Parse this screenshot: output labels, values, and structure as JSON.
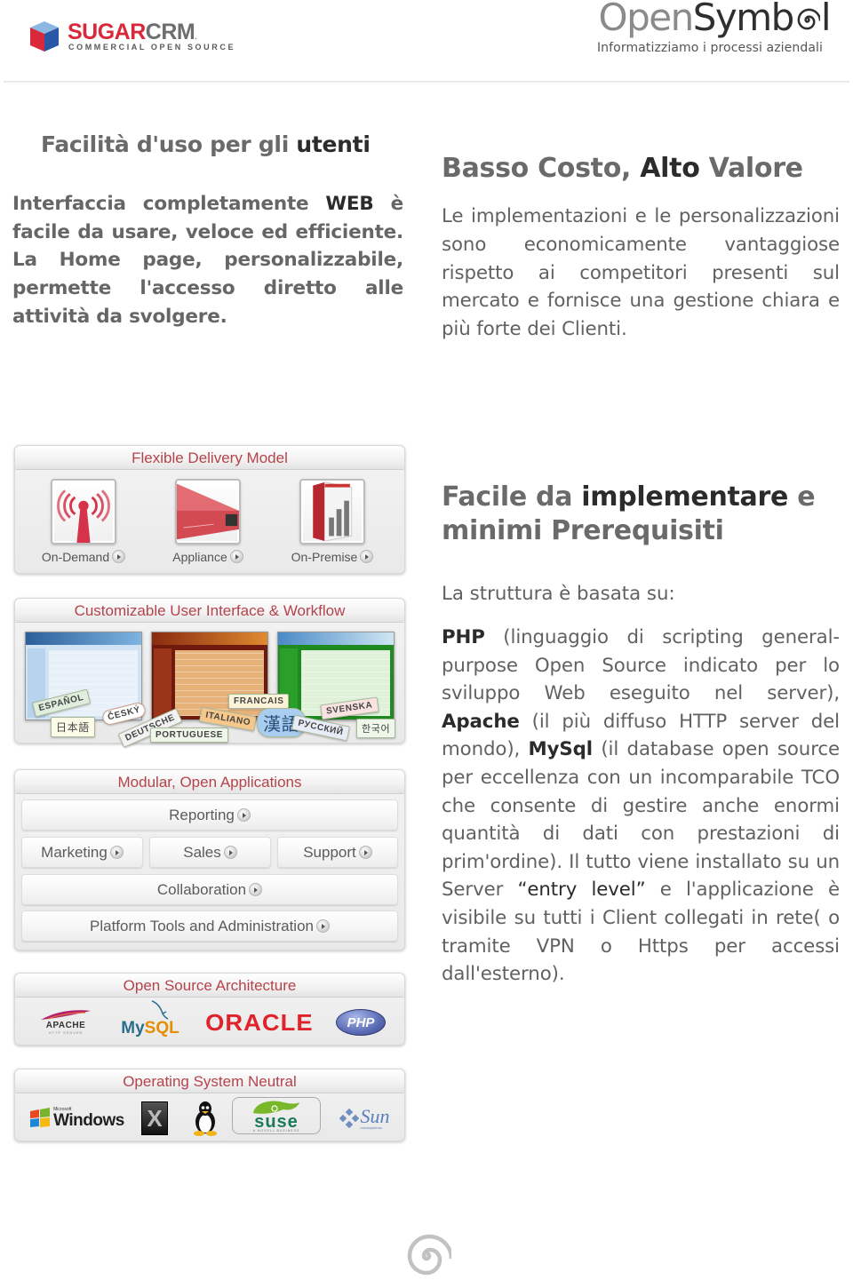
{
  "header": {
    "sugar_logo": {
      "word_red": "SUGAR",
      "word_grey": "CRM",
      "tm": ".",
      "subtitle": "COMMERCIAL OPEN SOURCE",
      "cube_colors": {
        "top": "#8db7e2",
        "left": "#d8283a",
        "right": "#2a56a6"
      }
    },
    "opensymbol_logo": {
      "word_light": "Open",
      "word_dark_a": "Symb",
      "word_dark_b": "l",
      "tagline": "Informatizziamo i processi aziendali"
    }
  },
  "section_ease": {
    "title_light": "Facilità d'uso per gli ",
    "title_dark": "utenti",
    "body_a": "Interfaccia completamente ",
    "body_bold": "WEB",
    "body_b": " è facile da usare, veloce ed efficiente. La Home page, personalizzabile, permette l'accesso diretto alle attività da svolgere."
  },
  "section_cost": {
    "title_light": "Basso Costo, ",
    "title_dark": "Alto",
    "title_light2": " Valore",
    "body": "Le implementazioni e le personalizzazioni sono economicamente vantaggiose rispetto ai competitori presenti sul mercato e fornisce una gestione chiara e più forte dei Clienti."
  },
  "section_impl": {
    "title_light": "Facile da ",
    "title_dark": "implementare",
    "title_light2": " e minimi Prerequisiti",
    "intro": "La struttura è basata su:",
    "php": "PHP",
    "php_desc": " (linguaggio di scripting general-purpose Open Source indicato per lo sviluppo Web eseguito nel server), ",
    "apache": "Apache",
    "apache_desc": " (il più diffuso HTTP server del mondo), ",
    "mysql": "MySql",
    "mysql_desc": " (il database open source per eccellenza con un incomparabile TCO che consente di gestire anche enormi quantità di dati con prestazioni di prim'ordine). Il tutto viene installato su un Server ",
    "entry": "“entry level”",
    "rest": " e l'applicazione è visibile su tutti i Client collegati in rete( o tramite VPN o Https per accessi dall'esterno)."
  },
  "panels": {
    "delivery": {
      "title": "Flexible Delivery Model",
      "items": [
        {
          "label": "On-Demand",
          "icon": "antenna-icon"
        },
        {
          "label": "Appliance",
          "icon": "server-appliance-icon"
        },
        {
          "label": "On-Premise",
          "icon": "software-box-icon"
        }
      ]
    },
    "ui": {
      "title": "Customizable User Interface & Workflow",
      "themes": [
        "blue",
        "orange",
        "green"
      ],
      "languages": [
        "ESPAÑOL",
        "日本語",
        "ČESKÝ",
        "DEUTSCHE",
        "PORTUGUESE",
        "FRANCAIS",
        "ITALIANO",
        "漢語",
        "РУССКИЙ",
        "SVENSKA",
        "한국어"
      ]
    },
    "modular": {
      "title": "Modular, Open Applications",
      "buttons": {
        "reporting": "Reporting",
        "marketing": "Marketing",
        "sales": "Sales",
        "support": "Support",
        "collaboration": "Collaboration",
        "platform": "Platform Tools and Administration"
      }
    },
    "architecture": {
      "title": "Open Source Architecture",
      "logos": {
        "apache": "APACHE",
        "apache_sub": "HTTP SERVER",
        "mysql_a": "My",
        "mysql_b": "SQL",
        "oracle": "ORACLE",
        "php": "PHP"
      }
    },
    "os": {
      "title": "Operating System Neutral",
      "logos": {
        "windows_small": "Microsoft",
        "windows": "Windows",
        "mac": "X",
        "suse": "suse",
        "suse_sub": "A NOVELL BUSINESS",
        "sun": "Sun",
        "sun_sub": "microsystems"
      }
    }
  },
  "colors": {
    "panel_title": "#b5434b",
    "text_grey": "#616161",
    "text_dark": "#2b2b2b"
  }
}
